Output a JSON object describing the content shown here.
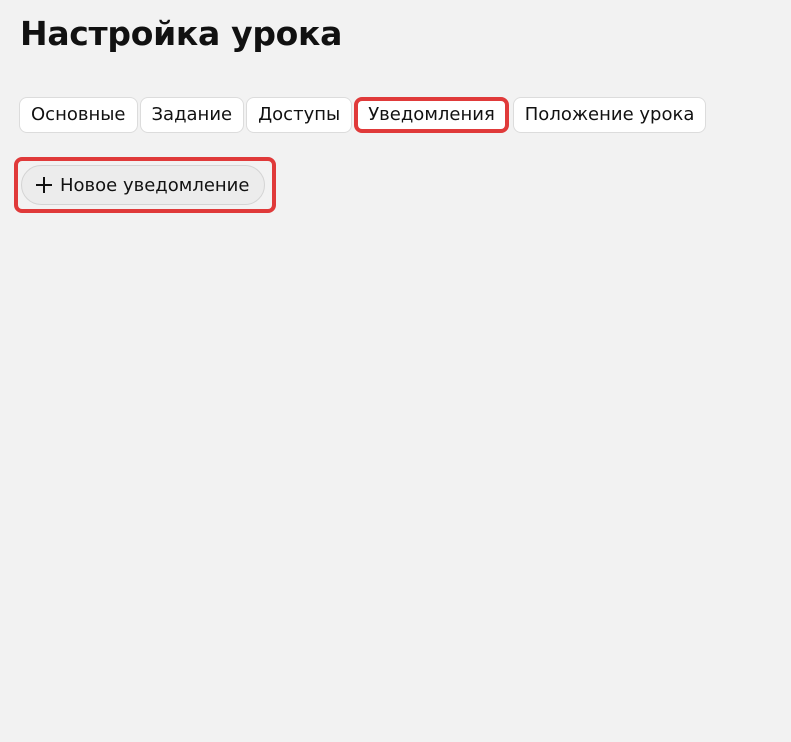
{
  "header": {
    "title": "Настройка урока"
  },
  "tabs": [
    {
      "label": "Основные",
      "active": false
    },
    {
      "label": "Задание",
      "active": false
    },
    {
      "label": "Доступы",
      "active": false
    },
    {
      "label": "Уведомления",
      "active": true
    },
    {
      "label": "Положение урока",
      "active": false
    }
  ],
  "notifications": {
    "add_button_label": "Новое уведомление",
    "add_button_icon": "plus-icon"
  },
  "colors": {
    "background": "#f2f2f2",
    "highlight": "#e03a3a",
    "tab_background": "#ffffff"
  }
}
